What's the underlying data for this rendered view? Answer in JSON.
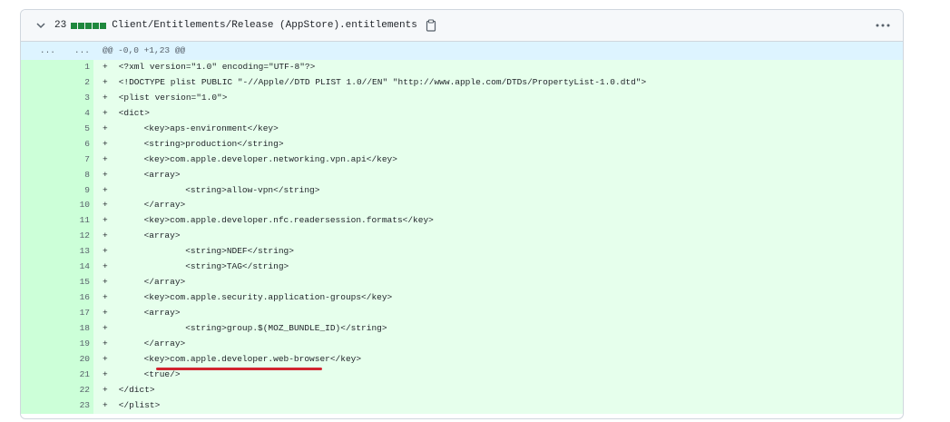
{
  "file": {
    "changes": "23",
    "name": "Client/Entitlements/Release (AppStore).entitlements"
  },
  "hunk": {
    "old_dots": "...",
    "new_dots": "...",
    "header": "@@ -0,0 +1,23 @@"
  },
  "lines": [
    {
      "n": "1",
      "text": "<?xml version=\"1.0\" encoding=\"UTF-8\"?>"
    },
    {
      "n": "2",
      "text": "<!DOCTYPE plist PUBLIC \"-//Apple//DTD PLIST 1.0//EN\" \"http://www.apple.com/DTDs/PropertyList-1.0.dtd\">"
    },
    {
      "n": "3",
      "text": "<plist version=\"1.0\">"
    },
    {
      "n": "4",
      "text": "<dict>"
    },
    {
      "n": "5",
      "text": "\t<key>aps-environment</key>"
    },
    {
      "n": "6",
      "text": "\t<string>production</string>"
    },
    {
      "n": "7",
      "text": "\t<key>com.apple.developer.networking.vpn.api</key>"
    },
    {
      "n": "8",
      "text": "\t<array>"
    },
    {
      "n": "9",
      "text": "\t\t<string>allow-vpn</string>"
    },
    {
      "n": "10",
      "text": "\t</array>"
    },
    {
      "n": "11",
      "text": "\t<key>com.apple.developer.nfc.readersession.formats</key>"
    },
    {
      "n": "12",
      "text": "\t<array>"
    },
    {
      "n": "13",
      "text": "\t\t<string>NDEF</string>"
    },
    {
      "n": "14",
      "text": "\t\t<string>TAG</string>"
    },
    {
      "n": "15",
      "text": "\t</array>"
    },
    {
      "n": "16",
      "text": "\t<key>com.apple.security.application-groups</key>"
    },
    {
      "n": "17",
      "text": "\t<array>"
    },
    {
      "n": "18",
      "text": "\t\t<string>group.$(MOZ_BUNDLE_ID)</string>"
    },
    {
      "n": "19",
      "text": "\t</array>"
    },
    {
      "n": "20",
      "text": "\t<key>com.apple.developer.web-browser</key>"
    },
    {
      "n": "21",
      "text": "\t<true/>"
    },
    {
      "n": "22",
      "text": "</dict>"
    },
    {
      "n": "23",
      "text": "</plist>"
    }
  ],
  "colors": {
    "added_bg": "#e6ffec",
    "added_num_bg": "#ccffd8",
    "hunk_bg": "#ddf4ff",
    "diffstat": "#1f883d",
    "annotation_underline": "#d1242f"
  }
}
